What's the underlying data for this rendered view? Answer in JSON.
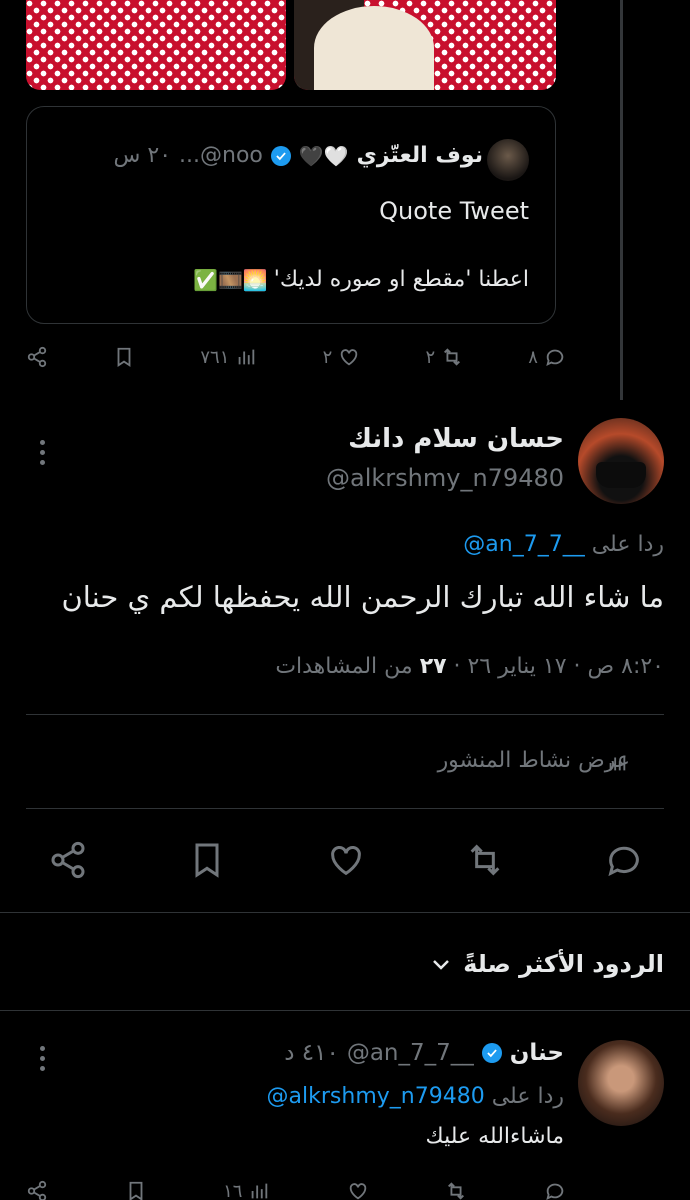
{
  "colors": {
    "background": "#000000",
    "text": "#e7e9ea",
    "muted": "#71767b",
    "link": "#1d9bf0",
    "divider": "#2f3336"
  },
  "quoted_tweet": {
    "name": "نوف العتّزي",
    "name_emojis": "🖤🤍",
    "handle": "...@noo",
    "time": "٢٠ س",
    "title": "Quote Tweet",
    "body": "اعطنا 'مقطع او صوره لديك'",
    "body_emojis": "✅🎞️🌅"
  },
  "parent_actions": {
    "replies": "٨",
    "reposts": "٢",
    "likes": "٢",
    "views": "٧٦١"
  },
  "main_reply": {
    "name": "حسان سلام دانك",
    "handle": "@alkrshmy_n79480",
    "reply_prefix": "ردا على",
    "reply_to": "@an_7_7__",
    "text": "ما شاء الله تبارك الرحمن الله يحفظها لكم ي حنان",
    "meta_datetime": "٨:٢٠ ص · ١٧ يناير ٢٦ ·",
    "views_count": "٢٧",
    "views_label": "من المشاهدات",
    "activity_label": "عرض نشاط المنشور"
  },
  "sort": {
    "label": "الردود الأكثر صلةً"
  },
  "reply": {
    "name": "حنان",
    "handle": "@an_7_7__",
    "time": "٤١٠ د",
    "reply_prefix": "ردا على",
    "reply_to": "@alkrshmy_n79480",
    "text": "ماشاءالله عليك",
    "actions": {
      "replies": "",
      "reposts": "",
      "likes": "",
      "views": "١٦"
    }
  },
  "icons": [
    "reply-icon",
    "repost-icon",
    "like-icon",
    "views-icon",
    "bookmark-icon",
    "share-icon",
    "verified-icon",
    "more-icon",
    "chevron-down-icon"
  ]
}
